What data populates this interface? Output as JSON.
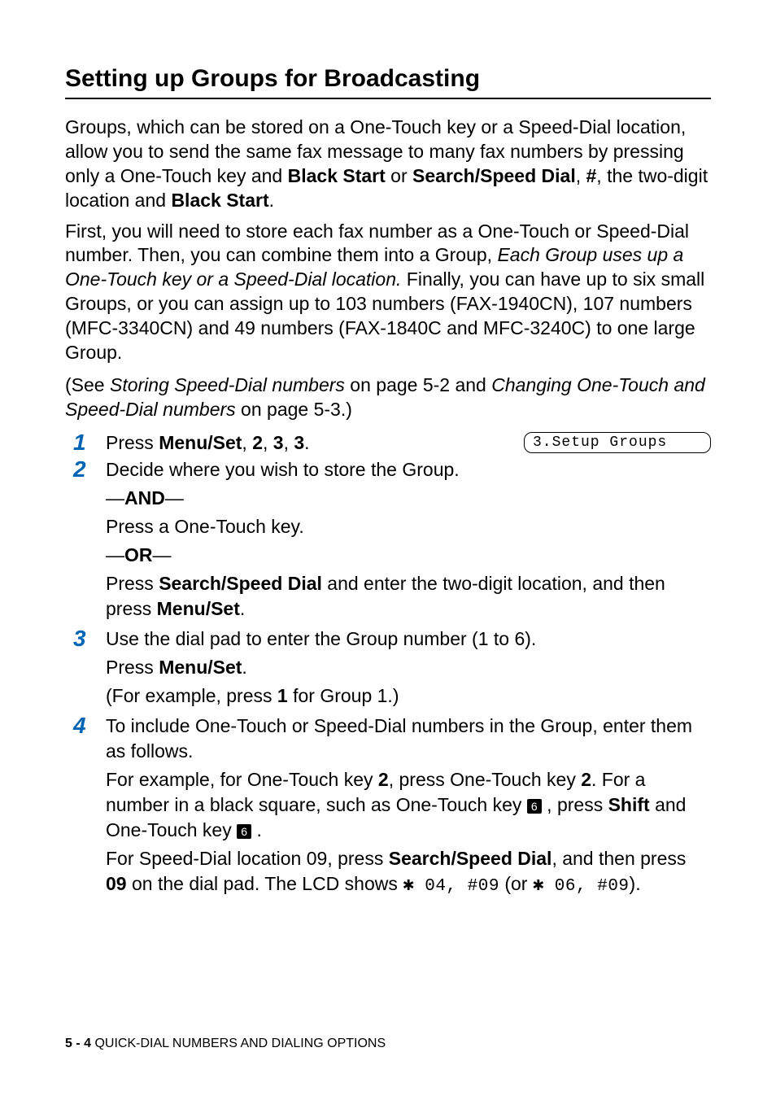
{
  "heading": "Setting up Groups for Broadcasting",
  "intro": {
    "p1_a": "Groups, which can be stored on a One-Touch key or a Speed-Dial location, allow you to send the same fax message to many fax numbers by pressing only a One-Touch key and ",
    "p1_b": "Black Start",
    "p1_c": " or ",
    "p1_d": "Search/Speed Dial",
    "p1_e": ", ",
    "p1_f": "#",
    "p1_g": ", the two-digit location and ",
    "p1_h": "Black Start",
    "p1_i": ".",
    "p2_a": "First, you will need to store each fax number as a One-Touch or Speed-Dial number. Then, you can combine them into a Group, ",
    "p2_b": "Each Group uses up a One-Touch key or a Speed-Dial location.",
    "p2_c": " Finally, you can have up to six small Groups, or you can assign up to 103 numbers (FAX-1940CN), 107 numbers (MFC-3340CN) and 49 numbers (FAX-1840C and MFC-3240C) to one large Group.",
    "p3_a": "(See ",
    "p3_b": "Storing Speed-Dial numbers",
    "p3_c": " on page 5-2 and ",
    "p3_d": "Changing One-Touch and Speed-Dial numbers",
    "p3_e": " on page 5-3.)"
  },
  "steps": {
    "s1": {
      "num": "1",
      "a": "Press ",
      "b": "Menu/Set",
      "c": ", ",
      "d": "2",
      "e": ", ",
      "f": "3",
      "g": ", ",
      "h": "3",
      "i": "."
    },
    "lcd": "3.Setup Groups  ",
    "s2": {
      "num": "2",
      "line1": "Decide where you wish to store the Group.",
      "and_a": "—",
      "and_b": "AND",
      "and_c": "—",
      "line2": "Press a One-Touch key.",
      "or_a": "—",
      "or_b": "OR",
      "or_c": "—",
      "line3_a": "Press ",
      "line3_b": "Search/Speed Dial",
      "line3_c": " and enter the two-digit location, and then press ",
      "line3_d": "Menu/Set",
      "line3_e": "."
    },
    "s3": {
      "num": "3",
      "line1": "Use the dial pad to enter the Group number (1 to 6).",
      "line2_a": "Press ",
      "line2_b": "Menu/Set",
      "line2_c": ".",
      "line3_a": "(For example, press ",
      "line3_b": "1",
      "line3_c": " for Group 1.)"
    },
    "s4": {
      "num": "4",
      "line1": "To include One-Touch or Speed-Dial numbers in the Group, enter them as follows.",
      "line2_a": "For example, for One-Touch key ",
      "line2_b": "2",
      "line2_c": ", press One-Touch key ",
      "line2_d": "2",
      "line2_e": ". For a number in a black square, such as One-Touch key ",
      "key6a": "6",
      "line2_f": " , press ",
      "line2_g": "Shift",
      "line2_h": " and One-Touch key ",
      "key6b": "6",
      "line2_i": " .",
      "line3_a": "For Speed-Dial location 09, press ",
      "line3_b": "Search/Speed Dial",
      "line3_c": ", and then press ",
      "line3_d": "09",
      "line3_e": " on the dial pad. The LCD shows  ",
      "mono1": " 04, #09",
      "line3_f": " (or ",
      "mono2": " 06, #09",
      "line3_g": ")."
    }
  },
  "footer": {
    "page": "5 - 4",
    "chapter": "   QUICK-DIAL NUMBERS AND DIALING OPTIONS"
  }
}
